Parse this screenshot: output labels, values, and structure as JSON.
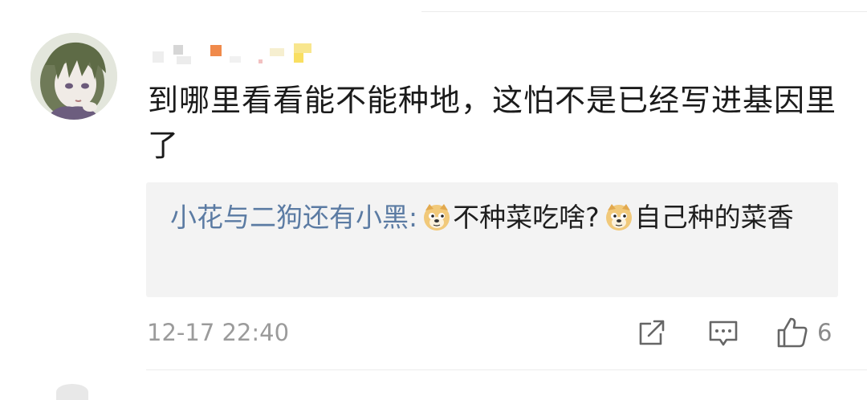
{
  "comment": {
    "text": "到哪里看看能不能种地，这怕不是已经写进基因里了",
    "timestamp": "12-17 22:40",
    "like_count": "6",
    "reply": {
      "author": "小花与二狗还有小黑:",
      "text_1": "不种菜吃啥?",
      "text_2": "自己种的菜香"
    }
  },
  "icons": {
    "reply": "doge-emoji",
    "share": "share-icon",
    "comment": "comment-icon",
    "like": "thumbs-up-icon"
  },
  "colors": {
    "author": "#5b7ba3",
    "reply_background": "#f3f3f3",
    "meta": "#9b9b9b"
  }
}
